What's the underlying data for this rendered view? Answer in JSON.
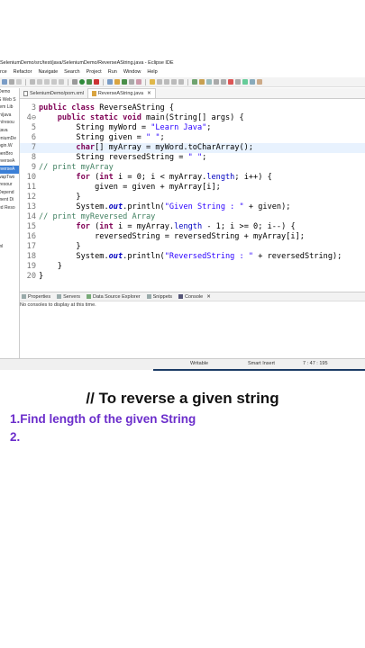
{
  "window_title": "SeleniumDemo/src/test/java/SeleniumDemo/ReverseAString.java - Eclipse IDE",
  "menu": [
    "rce",
    "Refactor",
    "Navigate",
    "Search",
    "Project",
    "Run",
    "Window",
    "Help"
  ],
  "tree_items": [
    "Demo",
    "S Web S",
    "tem Lib",
    "in/java",
    "in/resou",
    "/java",
    "eniumDe",
    "ogin.W",
    "penBro",
    "everseA",
    "everseA",
    "wapTwo",
    "/resour",
    "Depend",
    "ment Di",
    "ed Reso",
    "",
    "",
    "",
    "",
    "ml"
  ],
  "tabs": [
    "SeleniumDemo/pom.xml",
    "ReverseAString.java"
  ],
  "code": {
    "ln3": "3",
    "ln4": "4⊖",
    "ln5": "5",
    "ln6": "6",
    "ln7": "7",
    "ln8": "8",
    "ln9": "9",
    "ln10": "10",
    "ln11": "11",
    "ln12": "12",
    "ln13": "13",
    "ln14": "14",
    "ln15": "15",
    "ln16": "16",
    "ln17": "17",
    "ln18": "18",
    "ln19": "19",
    "ln20": "20",
    "s_public": "public",
    "s_class": "class",
    "s_classname": " ReverseAString {",
    "s_public2": "public",
    "s_static": "static",
    "s_void": "void",
    "s_main": " main(String[] args) {",
    "s_string": "String myWord = ",
    "s_learn": "\"Learn Java\"",
    "s_semi": ";",
    "s_given": "String given = ",
    "s_empty": "\" \"",
    "s_char": "char",
    "s_arr": "[] myArray = myWord.toCharArray();",
    "s_rev": "String reversedString = ",
    "s_cmt1": "// print myArray",
    "s_for": "for",
    "s_for1": " (",
    "s_int": "int",
    "s_for1b": " i = 0; i < myArray.",
    "s_length": "length",
    "s_for1c": "; i++) {",
    "s_given2": "given = given + myArray[i];",
    "s_close": "}",
    "s_sys": "System.",
    "s_out": "out",
    "s_println": ".println(",
    "s_givenstr": "\"Given String : \"",
    "s_plusgiven": " + given);",
    "s_cmt2": "// print myReversed Array",
    "s_for2": " i = myArray.",
    "s_for2c": " - 1; i >= 0; i--) {",
    "s_revline": "reversedString = reversedString + myArray[i];",
    "s_revstr": "\"ReversedString : \"",
    "s_plusrev": " + reversedString);",
    "s_close2": "}",
    "s_close3": "}"
  },
  "console_tabs": [
    "Properties",
    "Servers",
    "Data Source Explorer",
    "Snippets",
    "Console"
  ],
  "console_msg": "No consoles to display at this time.",
  "status": {
    "writable": "Writable",
    "insert": "Smart Insert",
    "pos": "7 : 47 : 195"
  },
  "heading": "// To reverse a given string",
  "step1": "1.Find length of the given String",
  "step2": "2."
}
